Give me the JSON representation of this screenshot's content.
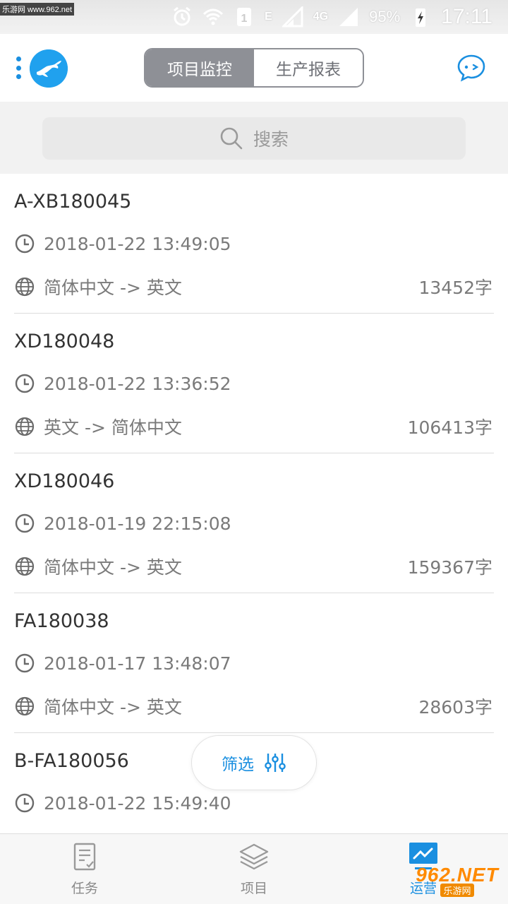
{
  "status_bar": {
    "watermark_top": "乐游网 www.962.net",
    "network_e": "E",
    "network_4g": "4G",
    "battery": "95%",
    "time": "17:11"
  },
  "header": {
    "tabs": [
      {
        "label": "项目监控",
        "active": true
      },
      {
        "label": "生产报表",
        "active": false
      }
    ]
  },
  "search": {
    "placeholder": "搜索"
  },
  "projects": [
    {
      "code": "A-XB180045",
      "time": "2018-01-22 13:49:05",
      "lang": "简体中文 -> 英文",
      "count": "13452字"
    },
    {
      "code": "XD180048",
      "time": "2018-01-22 13:36:52",
      "lang": "英文 -> 简体中文",
      "count": "106413字"
    },
    {
      "code": "XD180046",
      "time": "2018-01-19 22:15:08",
      "lang": "简体中文 -> 英文",
      "count": "159367字"
    },
    {
      "code": "FA180038",
      "time": "2018-01-17 13:48:07",
      "lang": "简体中文 -> 英文",
      "count": "28603字"
    },
    {
      "code": "B-FA180056",
      "time": "2018-01-22 15:49:40",
      "lang": "",
      "count": ""
    }
  ],
  "filter": {
    "label": "筛选"
  },
  "bottom_nav": [
    {
      "label": "任务",
      "icon": "task-icon"
    },
    {
      "label": "项目",
      "icon": "layers-icon"
    },
    {
      "label": "运营",
      "icon": "chart-icon",
      "active": true
    }
  ],
  "watermark": {
    "brand": "962.NET",
    "sub": "乐游网"
  },
  "colors": {
    "accent": "#1a8fe0",
    "segment_active": "#8e9096"
  }
}
